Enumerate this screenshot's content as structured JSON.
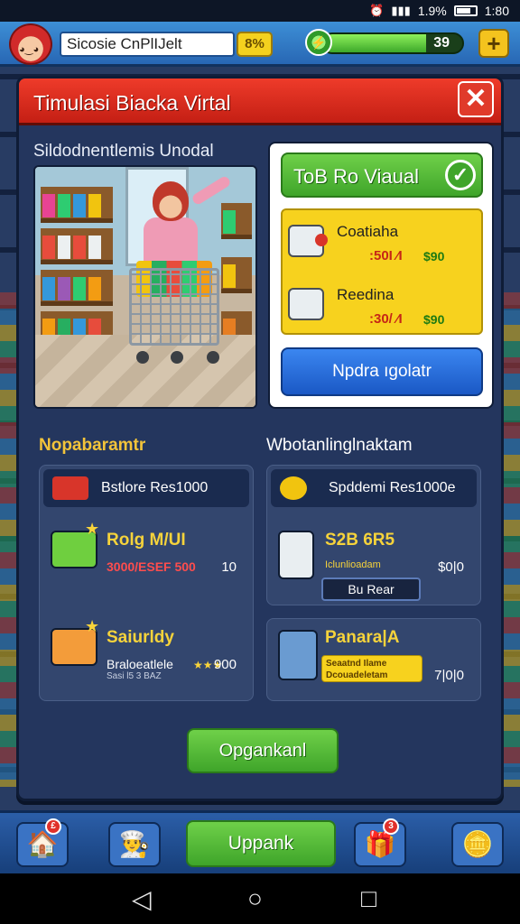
{
  "status_bar": {
    "alarm_icon": "alarm-icon",
    "signal_icon": "signal-icon",
    "battery_pct": "1.9%",
    "time": "1:80"
  },
  "top_bar": {
    "player_name": "Sicosie CnPlIJelt",
    "percent_badge": "8%",
    "energy_value": "39",
    "energy_fill": 0.74,
    "plus_label": "+"
  },
  "dialog": {
    "title": "Timulasi Biacka Virtal",
    "close_label": "✕",
    "section_title": "Sildodnentlemis Unodal",
    "store_card": {
      "title": "ToB Ro Viaual",
      "check": "✓",
      "items": [
        {
          "name": "Coatiaha",
          "old_price": ":50I ⁄I",
          "new_price": "$90"
        },
        {
          "name": "Reedina",
          "old_price": ":30/ ⁄I",
          "new_price": "$90"
        }
      ],
      "upgrade_button": "Npdra ıgolatr"
    },
    "left_column": {
      "label": "Nopabaramtr",
      "head": "Bstlore Res1000",
      "items": [
        {
          "name": "Rolg M/UI",
          "sub": "3000/ESEF 500",
          "price": "10"
        },
        {
          "name": "Saiurldy",
          "sub": "Braloeatlele",
          "sub2": "Sasi l5 3 BAZ",
          "price": "900"
        }
      ]
    },
    "right_column": {
      "label": "Wbotanlinglnaktam",
      "head": "Spddemi Res1000e",
      "items": [
        {
          "name": "S2B 6R5",
          "sub": "Iclunlioadam",
          "button": "Bu Rear",
          "price": "$0|0"
        },
        {
          "name": "Panara|A",
          "tag": "Seaatnd Ilame Dcouadeletam",
          "price": "7|0|0"
        }
      ]
    },
    "bottom_button": "Opgankanl"
  },
  "bottom_nav": {
    "main_label": "Uppank",
    "home_badge": "£",
    "gift_badge": "3"
  },
  "colors": {
    "accent_red": "#e03a2a",
    "accent_green": "#3fa52a",
    "accent_yellow": "#f7d21e",
    "accent_blue": "#1a58c5"
  }
}
